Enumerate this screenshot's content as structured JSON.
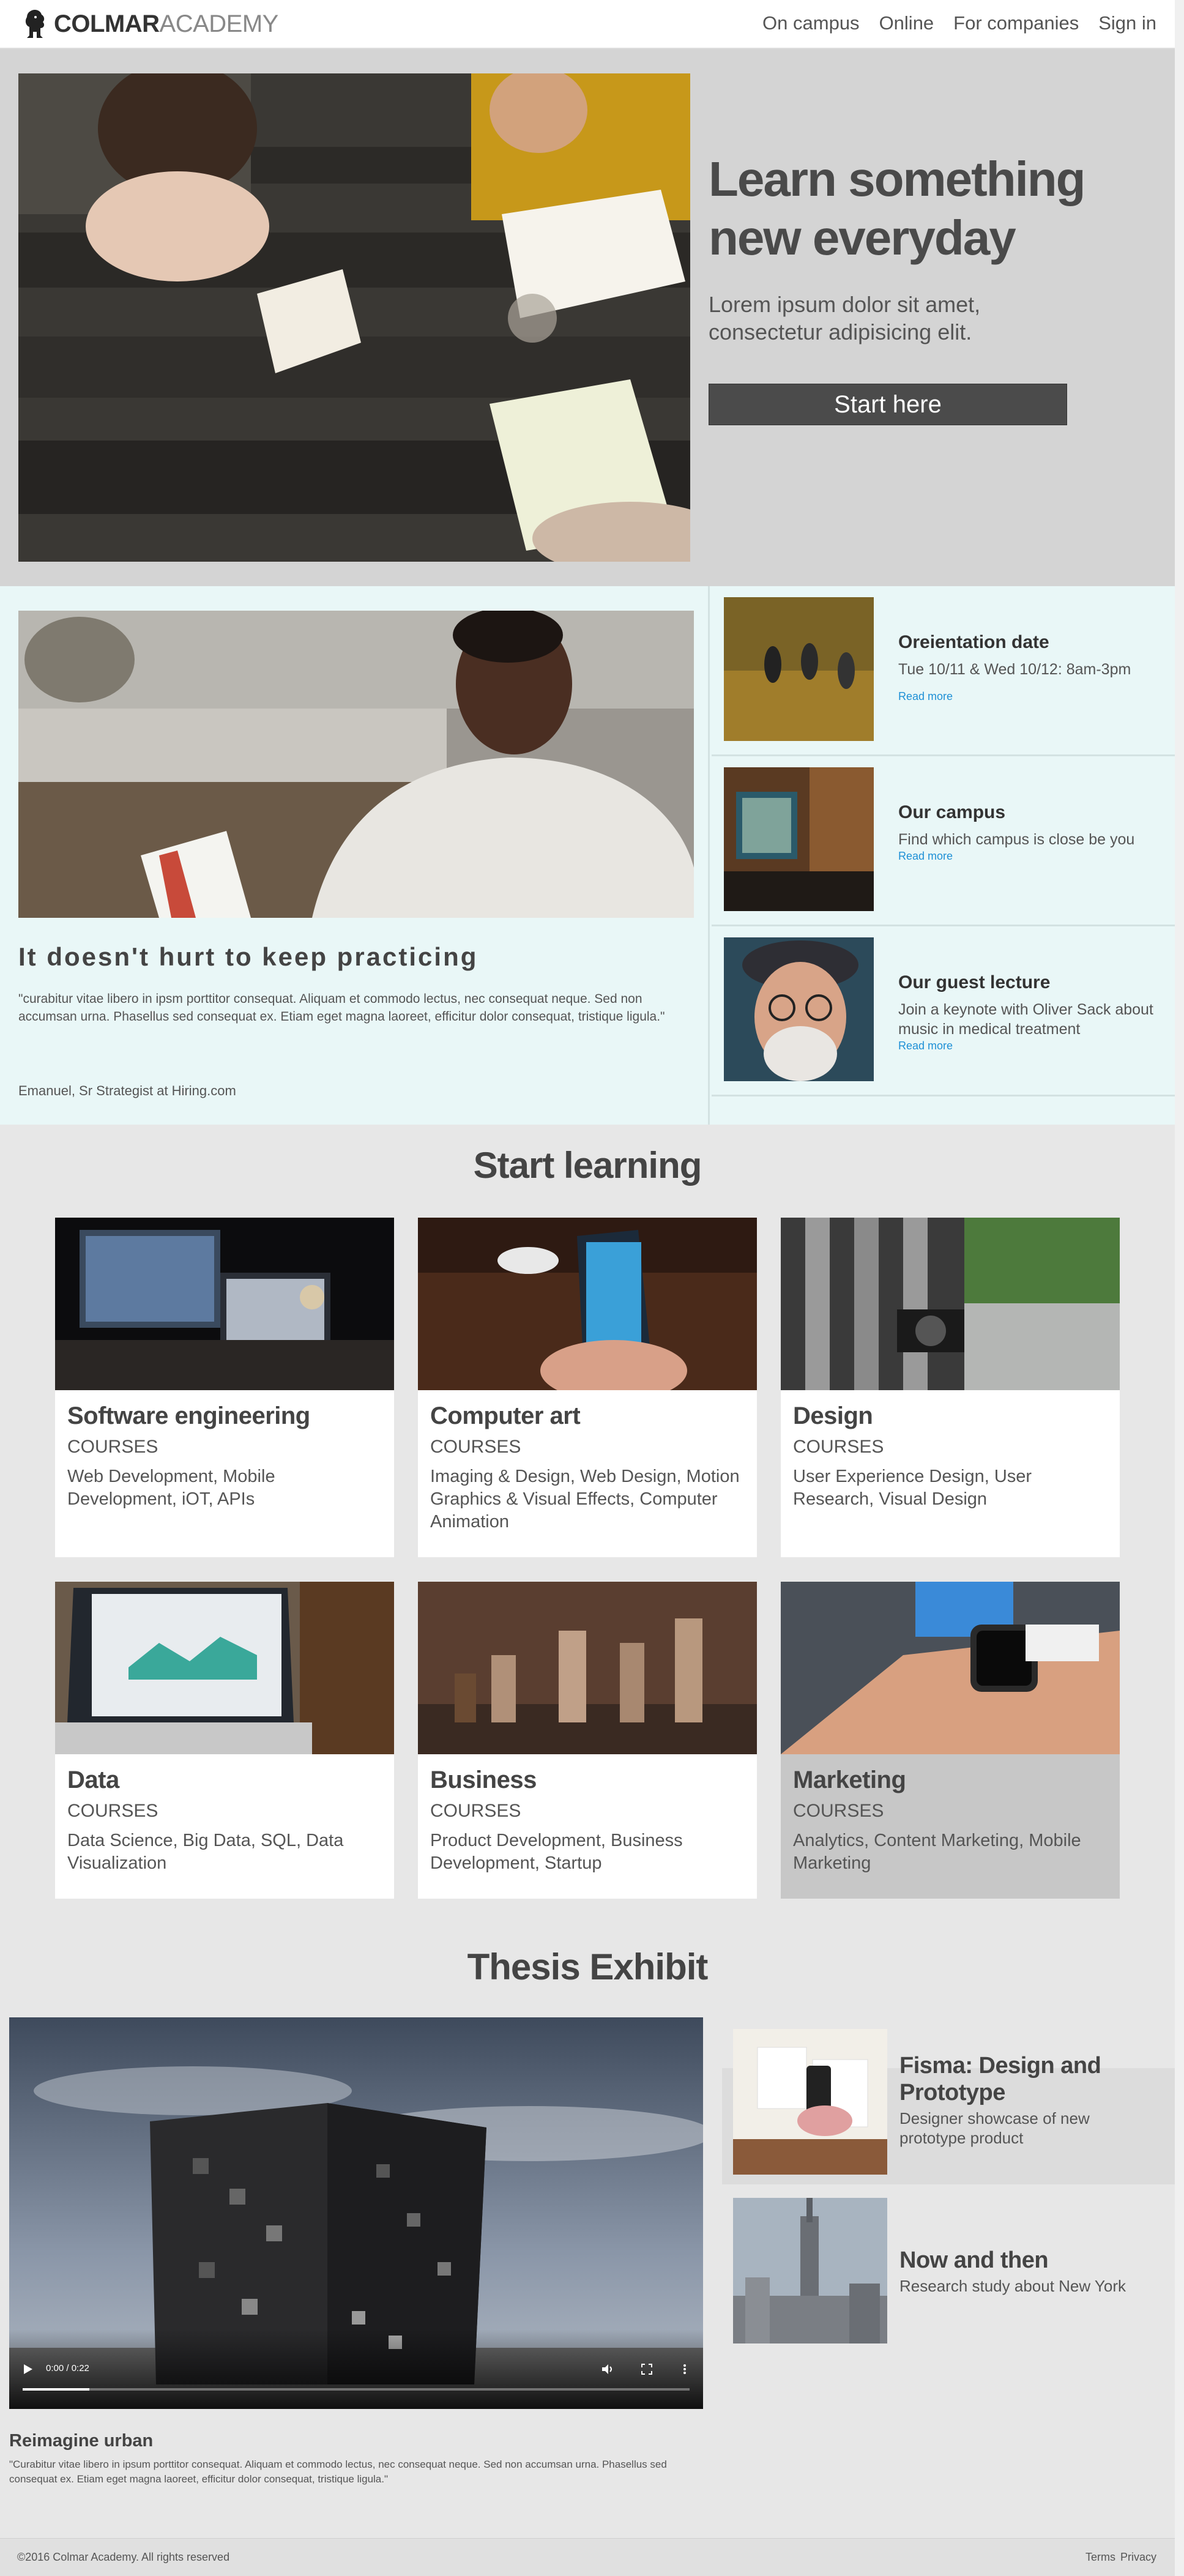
{
  "header": {
    "logo_bold": "COLMAR",
    "logo_light": "ACADEMY",
    "nav": [
      "On campus",
      "Online",
      "For companies",
      "Sign in"
    ]
  },
  "hero": {
    "title": "Learn something new everyday",
    "subtitle": "Lorem ipsum dolor sit amet, consectetur adipisicing elit.",
    "button": "Start here"
  },
  "practice": {
    "title": "It doesn't hurt to keep practicing",
    "quote": "\"curabitur vitae libero in ipsm porttitor consequat. Aliquam et commodo lectus, nec consequat neque. Sed non accumsan urna. Phasellus sed consequat ex. Etiam eget magna laoreet, efficitur dolor consequat, tristique ligula.\"",
    "author": "Emanuel, Sr Strategist at Hiring.com"
  },
  "events": [
    {
      "title": "Oreientation date",
      "desc": "Tue 10/11 & Wed 10/12: 8am-3pm",
      "more": "Read more"
    },
    {
      "title": "Our campus",
      "desc": "Find which campus is close be you",
      "more": "Read more"
    },
    {
      "title": "Our guest lecture",
      "desc": "Join a keynote with Oliver Sack about music in medical treatment",
      "more": "Read more"
    }
  ],
  "start_learning": {
    "title": "Start learning",
    "cards": [
      {
        "title": "Software engineering",
        "sub": "COURSES",
        "desc": "Web Development, Mobile Development, iOT, APIs"
      },
      {
        "title": "Computer art",
        "sub": "COURSES",
        "desc": "Imaging & Design, Web Design, Motion Graphics & Visual Effects, Computer Animation"
      },
      {
        "title": "Design",
        "sub": "COURSES",
        "desc": "User Experience Design, User Research, Visual Design"
      },
      {
        "title": "Data",
        "sub": "COURSES",
        "desc": "Data Science, Big Data, SQL, Data Visualization"
      },
      {
        "title": "Business",
        "sub": "COURSES",
        "desc": "Product Development, Business Development, Startup"
      },
      {
        "title": "Marketing",
        "sub": "COURSES",
        "desc": "Analytics, Content Marketing, Mobile Marketing"
      }
    ]
  },
  "thesis": {
    "title": "Thesis Exhibit",
    "video_time": "0:00 / 0:22",
    "video_progress": 0.1,
    "video_title": "Reimagine urban",
    "video_quote": "\"Curabitur vitae libero in ipsum porttitor consequat. Aliquam et commodo lectus, nec consequat neque. Sed non accumsan urna. Phasellus sed consequat ex. Etiam eget magna laoreet, efficitur dolor consequat, tristique ligula.\"",
    "items": [
      {
        "title": "Fisma: Design and Prototype",
        "desc": "Designer showcase of new prototype product"
      },
      {
        "title": "Now and then",
        "desc": "Research study about New York"
      }
    ]
  },
  "footer": {
    "copyright": "©2016 Colmar Academy. All rights reserved",
    "terms": "Terms",
    "privacy": "Privacy"
  }
}
